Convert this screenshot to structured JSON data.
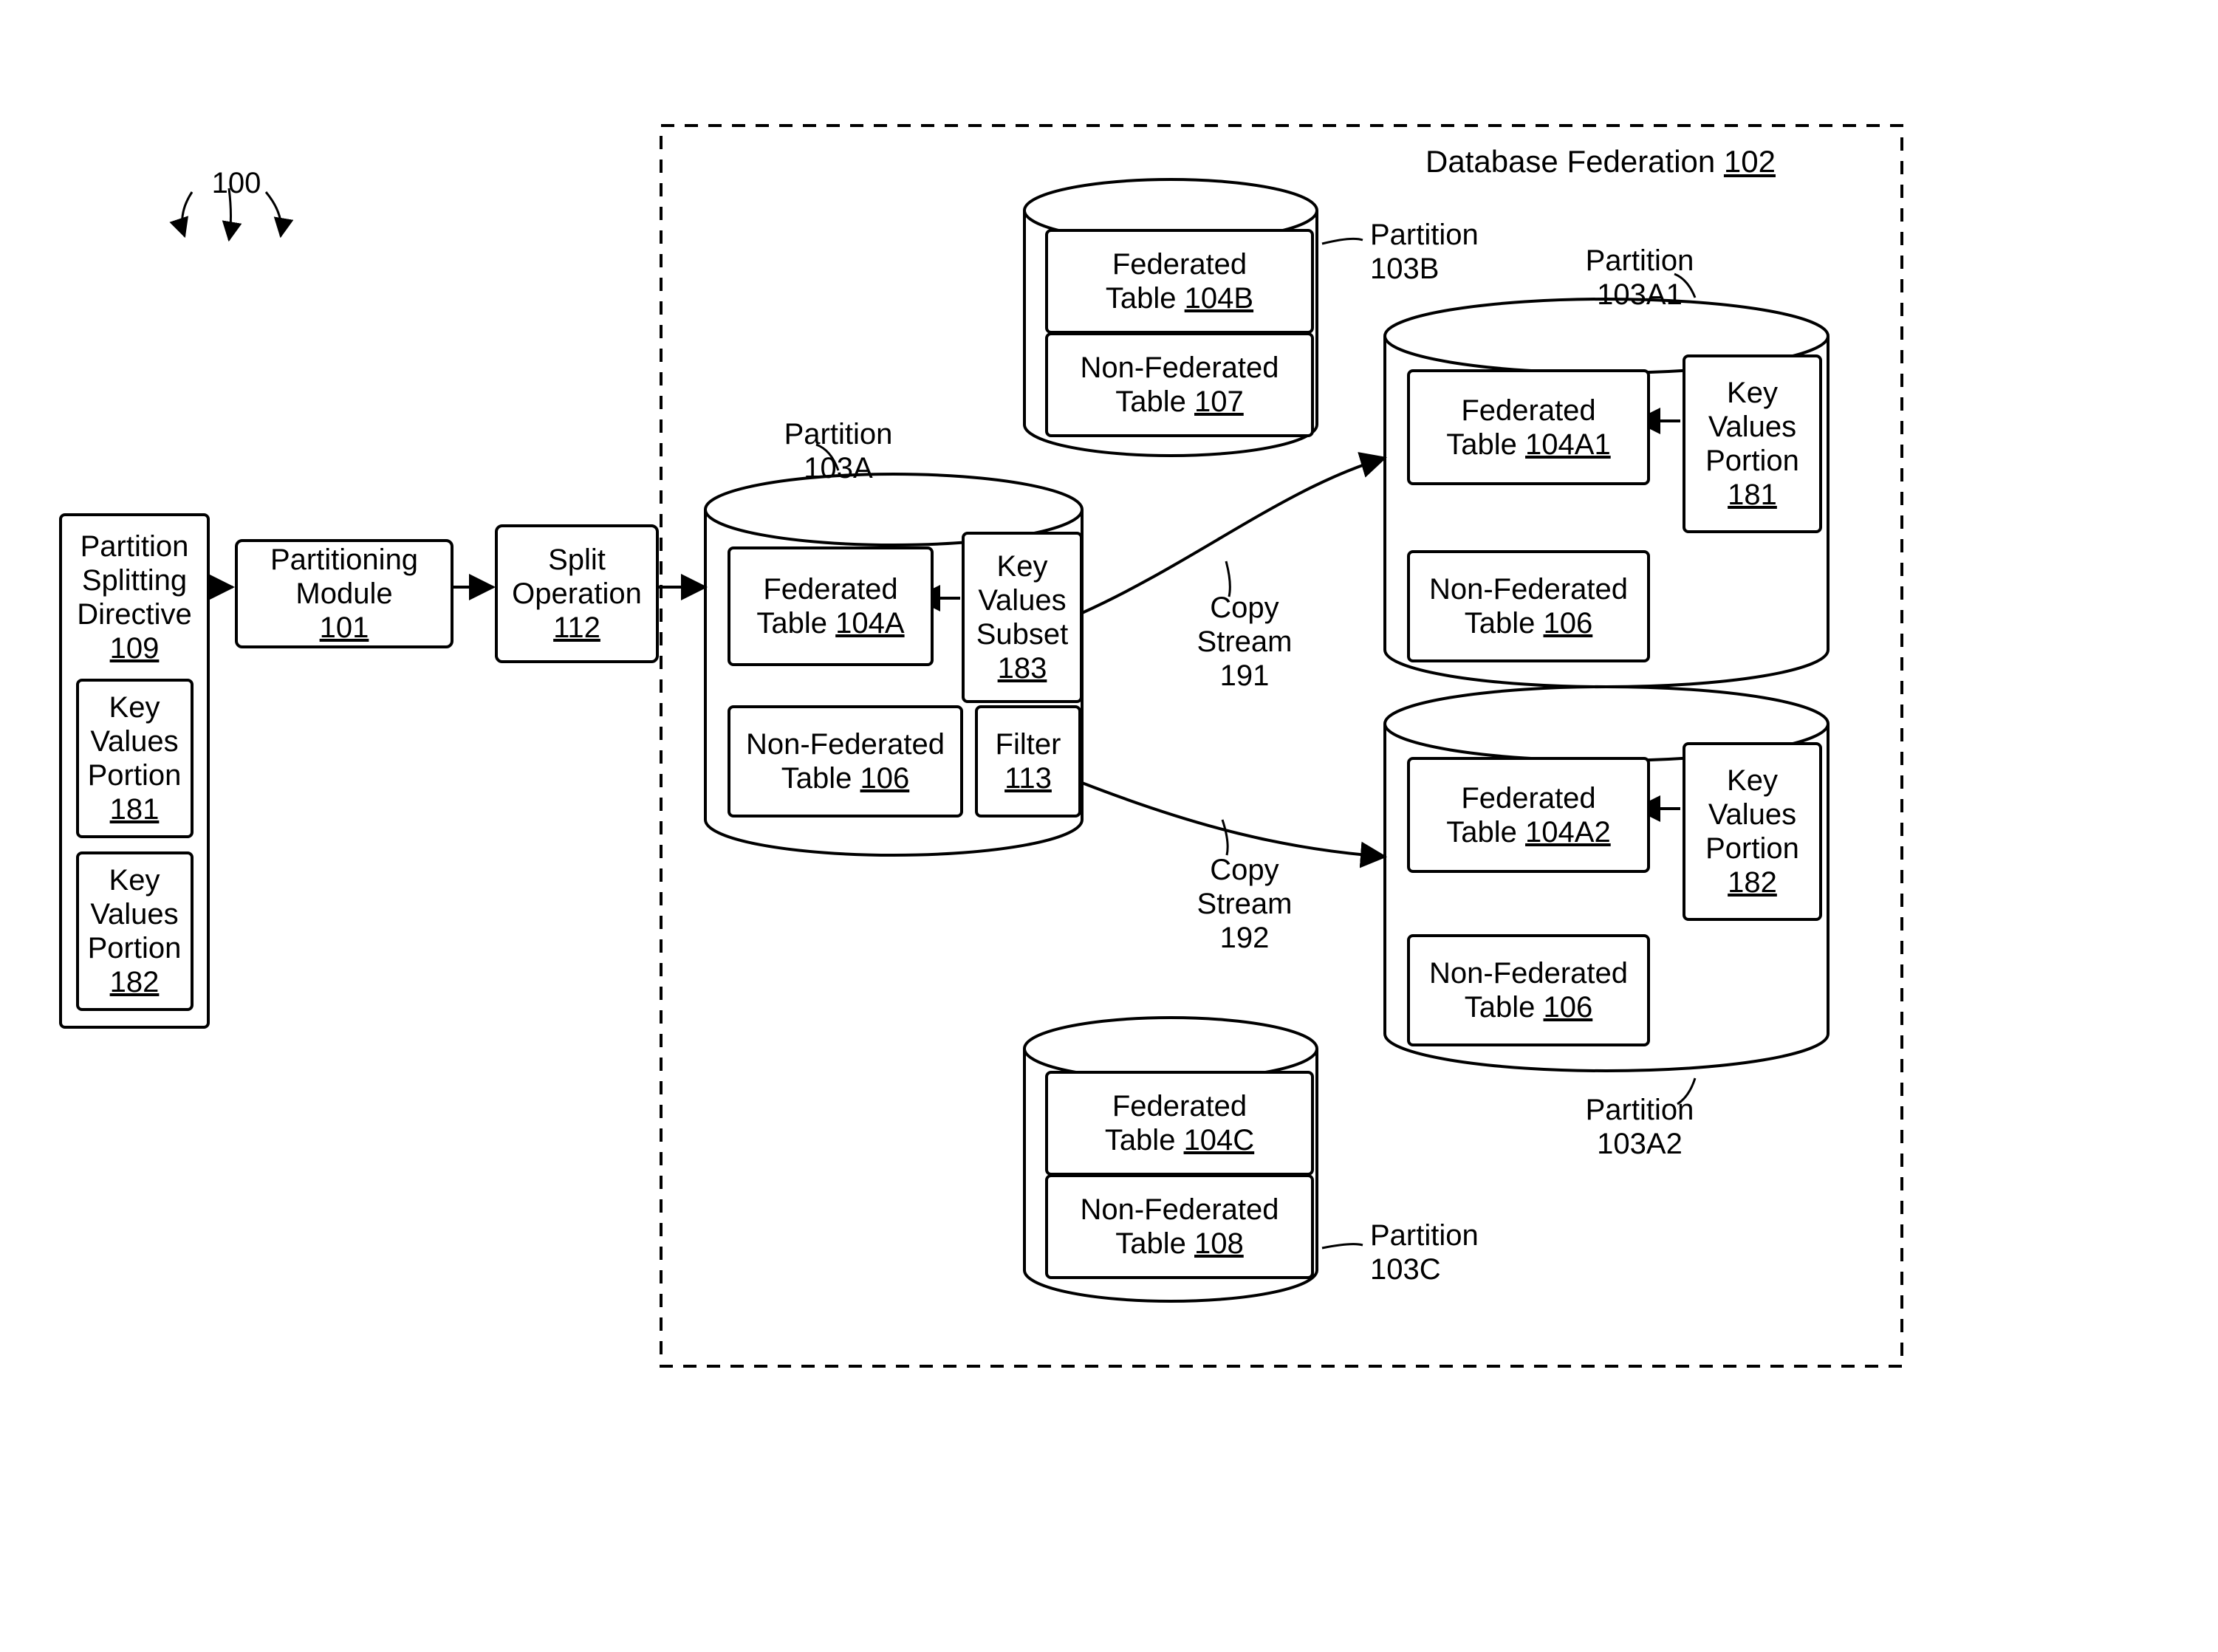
{
  "fig_ref": {
    "label": "100"
  },
  "directive": {
    "title_l1": "Partition",
    "title_l2": "Splitting",
    "title_l3": "Directive",
    "ref": "109",
    "kvp1_l1": "Key",
    "kvp1_l2": "Values",
    "kvp1_l3": "Portion",
    "kvp1_ref": "181",
    "kvp2_l1": "Key",
    "kvp2_l2": "Values",
    "kvp2_l3": "Portion",
    "kvp2_ref": "182"
  },
  "partitioning_module": {
    "l1": "Partitioning",
    "l2": "Module ",
    "ref": "101"
  },
  "split_op": {
    "l1": "Split",
    "l2": "Operation",
    "ref": "112"
  },
  "federation": {
    "title": "Database Federation  ",
    "ref": "102"
  },
  "p103a": {
    "label_l1": "Partition",
    "label_l2": "103A",
    "fed_l1": "Federated",
    "fed_l2": "Table ",
    "fed_ref": "104A",
    "kvs_l1": "Key",
    "kvs_l2": "Values",
    "kvs_l3": "Subset",
    "kvs_ref": "183",
    "nonfed_l1": "Non-Federated",
    "nonfed_l2": "Table ",
    "nonfed_ref": "106",
    "filter_l1": "Filter",
    "filter_ref": "113"
  },
  "p103b": {
    "label_l1": "Partition",
    "label_l2": "103B",
    "fed_l1": "Federated",
    "fed_l2": "Table ",
    "fed_ref": "104B",
    "nonfed_l1": "Non-Federated",
    "nonfed_l2": "Table ",
    "nonfed_ref": "107"
  },
  "p103c": {
    "label_l1": "Partition",
    "label_l2": "103C",
    "fed_l1": "Federated",
    "fed_l2": "Table ",
    "fed_ref": "104C",
    "nonfed_l1": "Non-Federated",
    "nonfed_l2": "Table ",
    "nonfed_ref": "108"
  },
  "p103a1": {
    "label_l1": "Partition",
    "label_l2": "103A1",
    "fed_l1": "Federated",
    "fed_l2": "Table ",
    "fed_ref": "104A1",
    "kvp_l1": "Key",
    "kvp_l2": "Values",
    "kvp_l3": "Portion",
    "kvp_ref": "181",
    "nonfed_l1": "Non-Federated",
    "nonfed_l2": "Table ",
    "nonfed_ref": "106"
  },
  "p103a2": {
    "label_l1": "Partition",
    "label_l2": "103A2",
    "fed_l1": "Federated",
    "fed_l2": "Table ",
    "fed_ref": "104A2",
    "kvp_l1": "Key",
    "kvp_l2": "Values",
    "kvp_l3": "Portion",
    "kvp_ref": "182",
    "nonfed_l1": "Non-Federated",
    "nonfed_l2": "Table ",
    "nonfed_ref": "106"
  },
  "copy191": {
    "l1": "Copy",
    "l2": "Stream",
    "l3": "191"
  },
  "copy192": {
    "l1": "Copy",
    "l2": "Stream",
    "l3": "192"
  }
}
